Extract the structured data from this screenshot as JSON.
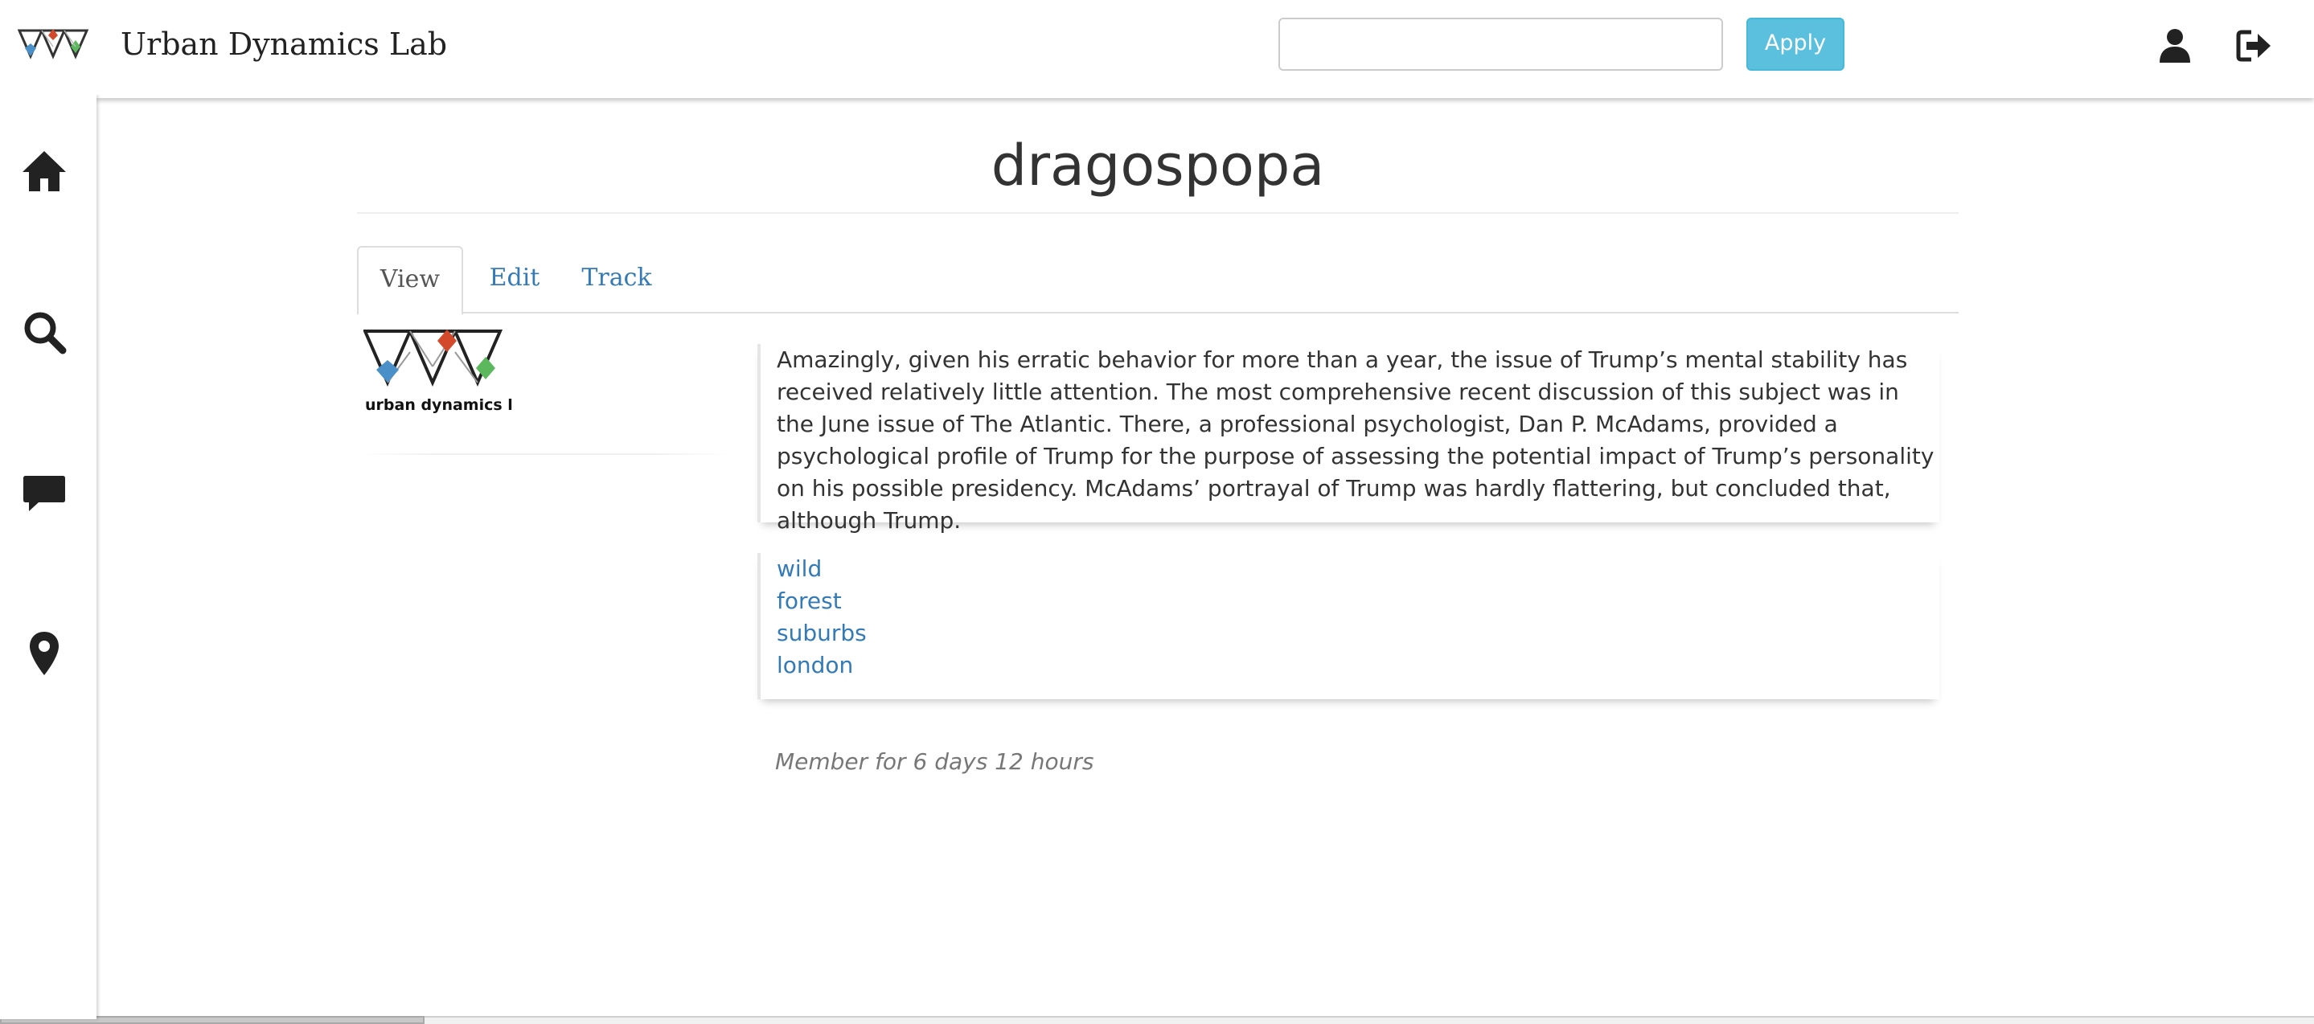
{
  "app": {
    "brand_name": "Urban Dynamics Lab",
    "logo_caption": "urban dynamics lab"
  },
  "header": {
    "search_value": "",
    "apply_label": "Apply",
    "icons": [
      "user-icon",
      "sign-out-icon"
    ]
  },
  "sidebar": {
    "items": [
      {
        "icon": "home-icon"
      },
      {
        "icon": "search-icon"
      },
      {
        "icon": "comment-icon"
      },
      {
        "icon": "map-marker-icon"
      }
    ]
  },
  "page": {
    "title": "dragospopa",
    "tabs": [
      {
        "label": "View",
        "active": true
      },
      {
        "label": "Edit",
        "active": false
      },
      {
        "label": "Track",
        "active": false
      }
    ],
    "bio": "Amazingly, given his erratic behavior for more than a year, the issue of Trump’s mental stability has received relatively little attention. The most comprehensive recent discussion of this subject was in the June issue of The Atlantic. There, a professional psychologist, Dan P. McAdams, provided a psychological profile of Trump for the purpose of assessing the potential impact of Trump’s personality on his possible presidency. McAdams’ portrayal of Trump was hardly flattering, but concluded that, although Trump.",
    "tags": [
      "wild",
      "forest",
      "suburbs",
      "london"
    ],
    "member_since": "Member for 6 days 12 hours"
  },
  "colors": {
    "link": "#337ab7",
    "apply_button": "#5bc0de",
    "logo_blue": "#4a90c8",
    "logo_red": "#d24a2b",
    "logo_green": "#5cb85c"
  }
}
